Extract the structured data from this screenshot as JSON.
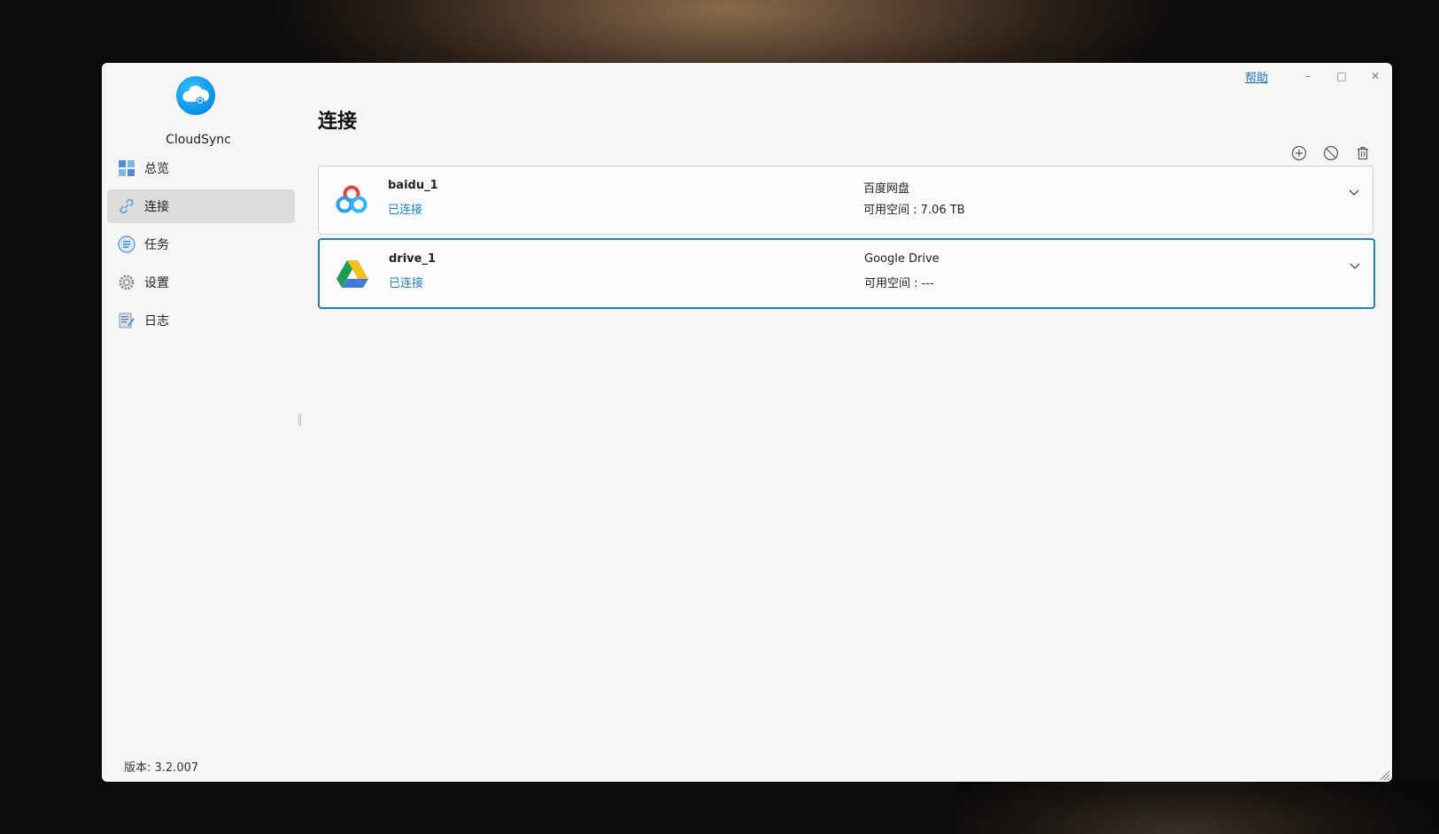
{
  "window": {
    "help_label": "帮助",
    "minimize_glyph": "–",
    "maximize_glyph": "□",
    "close_glyph": "✕"
  },
  "sidebar": {
    "app_name": "CloudSync",
    "items": [
      {
        "label": "总览",
        "icon": "dashboard-icon"
      },
      {
        "label": "连接",
        "icon": "link-icon"
      },
      {
        "label": "任务",
        "icon": "task-list-icon"
      },
      {
        "label": "设置",
        "icon": "gear-icon"
      },
      {
        "label": "日志",
        "icon": "log-icon"
      }
    ],
    "active_index": 1,
    "version": "版本: 3.2.007"
  },
  "main": {
    "title": "连接",
    "toolbar": [
      "add-circle-icon",
      "disable-icon",
      "trash-icon"
    ],
    "connections": [
      {
        "name": "baidu_1",
        "status": "已连接",
        "type": "百度网盘",
        "space": "可用空间 : 7.06 TB",
        "icon": "baidu-netdisk-icon"
      },
      {
        "name": "drive_1",
        "status": "已连接",
        "type": "Google Drive",
        "space": "可用空间 : ---",
        "icon": "google-drive-icon"
      }
    ],
    "selected_index": 1
  },
  "colors": {
    "accent": "#1d7fd6",
    "window_bg": "#f6f6f6",
    "active_nav_bg": "#dcdcdc"
  }
}
